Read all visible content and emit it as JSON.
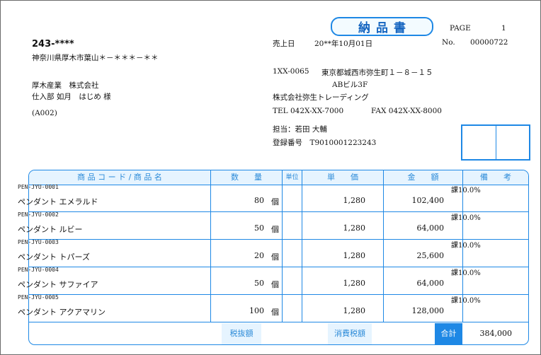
{
  "header": {
    "title": "納品書",
    "page_label": "PAGE",
    "page_number": "1",
    "sale_date_label": "売上日",
    "sale_date": "20**年10月01日",
    "no_label": "No.",
    "no_value": "00000722"
  },
  "recipient": {
    "postal": "243-****",
    "address": "神奈川県厚木市葉山＊－＊＊＊－＊＊",
    "company": "厚木産業　株式会社",
    "person": "仕入部 如月　はじめ 様",
    "code": "(A002)"
  },
  "sender": {
    "postal": "1XX-0065",
    "address": "東京都城西市弥生町１－８－１５",
    "building": "ABビル3F",
    "company": "株式会社弥生トレーディング",
    "tel": "TEL 042X-XX-7000",
    "fax": "FAX 042X-XX-8000",
    "staff": "担当：若田 大輔",
    "registration": "登録番号　T9010001223243"
  },
  "table": {
    "headers": {
      "item": "商 品 コ ー ド / 商 品 名",
      "qty": "数　　量",
      "unit": "単位",
      "price": "単　　価",
      "amount": "金　　額",
      "note": "備　　考"
    },
    "rows": [
      {
        "code": "PEN-JYU-0001",
        "name": "ペンダント エメラルド",
        "qty": "80",
        "unit": "個",
        "price": "1,280",
        "amount": "102,400",
        "tax": "課10.0%"
      },
      {
        "code": "PEN-JYU-0002",
        "name": "ペンダント ルビー",
        "qty": "50",
        "unit": "個",
        "price": "1,280",
        "amount": "64,000",
        "tax": "課10.0%"
      },
      {
        "code": "PEN-JYU-0003",
        "name": "ペンダント トパーズ",
        "qty": "20",
        "unit": "個",
        "price": "1,280",
        "amount": "25,600",
        "tax": "課10.0%"
      },
      {
        "code": "PEN-JYU-0004",
        "name": "ペンダント サファイア",
        "qty": "50",
        "unit": "個",
        "price": "1,280",
        "amount": "64,000",
        "tax": "課10.0%"
      },
      {
        "code": "PEN-JYU-0005",
        "name": "ペンダント アクアマリン",
        "qty": "100",
        "unit": "個",
        "price": "1,280",
        "amount": "128,000",
        "tax": "課10.0%"
      }
    ],
    "footer": {
      "subtotal_label": "税抜額",
      "tax_label": "消費税額",
      "total_label": "合計",
      "total_value": "384,000"
    }
  }
}
